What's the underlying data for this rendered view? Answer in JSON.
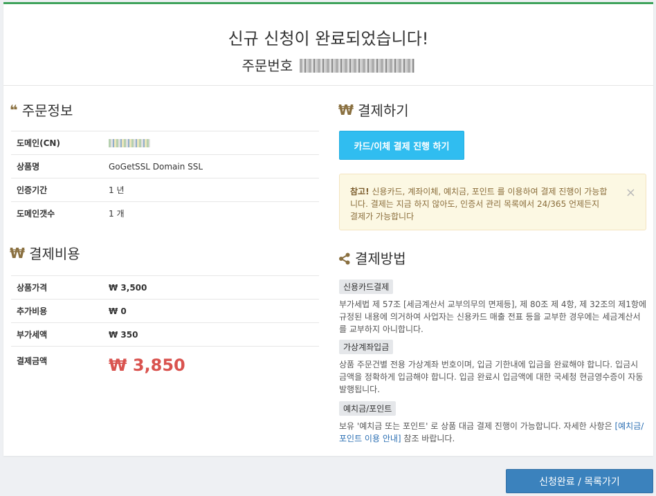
{
  "header": {
    "title": "신규 신청이 완료되었습니다!",
    "order_label": "주문번호"
  },
  "order_info": {
    "title": "주문정보",
    "rows": [
      {
        "label": "도메인(CN)",
        "value": ""
      },
      {
        "label": "상품명",
        "value": "GoGetSSL Domain SSL"
      },
      {
        "label": "인증기간",
        "value": "1 년"
      },
      {
        "label": "도메인갯수",
        "value": "1 개"
      }
    ]
  },
  "cost": {
    "title": "결제비용",
    "rows": [
      {
        "label": "상품가격",
        "value": "₩ 3,500"
      },
      {
        "label": "추가비용",
        "value": "₩ 0"
      },
      {
        "label": "부가세액",
        "value": "₩ 350"
      },
      {
        "label": "결제금액",
        "value": "₩ 3,850"
      }
    ]
  },
  "payment": {
    "title": "결제하기",
    "button_label": "카드/이체 결제 진행 하기",
    "alert_bold": "참고!",
    "alert_text": "신용카드, 계좌이체, 예치금, 포인트 를 이용하여 결제 진행이 가능합니다. 결제는 지금 하지 않아도, 인증서 관리 목록에서 24/365 언제든지 결제가 가능합니다",
    "alert_close": "×"
  },
  "methods": {
    "title": "결제방법",
    "items": [
      {
        "badge": "신용카드결제",
        "text": "부가세법 제 57조 [세금계산서 교부의무의 면제등], 제 80조 제 4항, 제 32조의 제1항에 규정된 내용에 의거하여 사업자는 신용카드 매출 전표 등을 교부한 경우에는 세금계산서를 교부하지 아니합니다."
      },
      {
        "badge": "가상계좌입금",
        "text": "상품 주문건별 전용 가상계좌 번호이며, 입금 기한내에 입금을 완료해야 합니다. 입금시 금액을 정확하게 입금해야 합니다. 입금 완료시 입금액에 대한 국세청 현금영수증이 자동 발행됩니다."
      },
      {
        "badge": "예치금/포인트",
        "text_before": "보유 '예치금 또는 포인트' 로 상품 대금 결제 진행이 가능합니다. 자세한 사항은 ",
        "link": "[예치금/포인트 이용 안내]",
        "text_after": " 참조 바랍니다."
      }
    ]
  },
  "footer": {
    "done_label": "신청완료 / 목록가기"
  },
  "icons": {
    "quote": "quote-icon",
    "won": "won-icon",
    "share": "share-icon"
  },
  "colors": {
    "accent_green": "#3fa35c",
    "pay_button": "#30bdf0",
    "done_button": "#3b82bd",
    "total_red": "#d9534f",
    "icon_brown": "#8a7040"
  }
}
